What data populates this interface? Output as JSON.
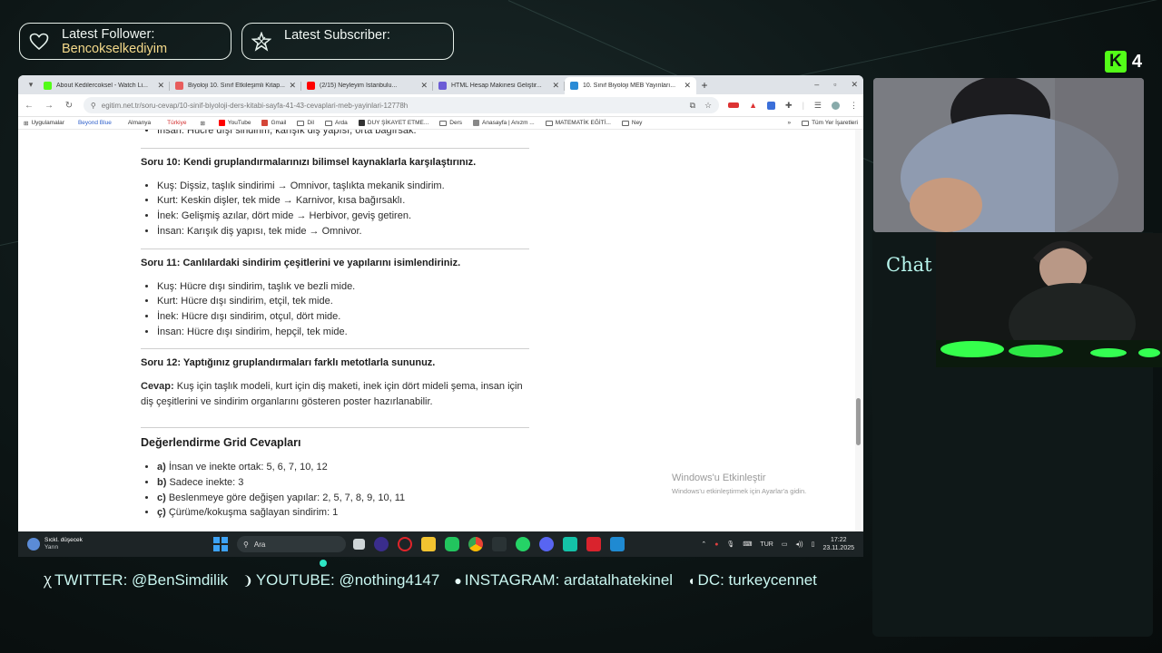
{
  "overlay": {
    "latest_follower_label": "Latest Follower:",
    "latest_follower_name": "Bencokselkediyim",
    "latest_subscriber_label": "Latest Subscriber:",
    "latest_subscriber_name": "",
    "brand_count": "4",
    "chat_title": "Chat",
    "socials": [
      {
        "icon": "twitter-icon",
        "text": "TWITTER: @BenSimdilik"
      },
      {
        "icon": "youtube-icon",
        "text": "YOUTUBE: @nothing4147"
      },
      {
        "icon": "instagram-icon",
        "text": "INSTAGRAM: ardatalhatekinel"
      },
      {
        "icon": "discord-icon",
        "text": "DC: turkeycennet"
      }
    ]
  },
  "browser": {
    "tabs": [
      {
        "title": "About Kedilercoksel - Watch Li...",
        "favicon_color": "#53fc18",
        "active": false
      },
      {
        "title": "Biyoloji 10. Sınıf Etkileşimli Kitap...",
        "favicon_color": "#e85d5d",
        "active": false
      },
      {
        "title": "(2/15) Neyleyim İstanbulu...",
        "favicon_color": "#ff0000",
        "active": false
      },
      {
        "title": "HTML Hesap Makinesi Geliştir...",
        "favicon_color": "#6b5bd6",
        "active": false
      },
      {
        "title": "10. Sınıf Biyoloji MEB Yayınları...",
        "favicon_color": "#2a8bd6",
        "active": true
      }
    ],
    "url": "egitim.net.tr/soru-cevap/10-sinif-biyoloji-ders-kitabi-sayfa-41-43-cevaplari-meb-yayinlari-12778h",
    "bookmarks": [
      {
        "label": "Uygulamalar",
        "type": "apps"
      },
      {
        "label": "Beyond Blue",
        "type": "badge",
        "color": "#2b5dc9"
      },
      {
        "label": "Almanya",
        "type": "badge",
        "color": "#333333"
      },
      {
        "label": "Türkiye",
        "type": "badge",
        "color": "#d22c2c"
      },
      {
        "label": "",
        "type": "grid"
      },
      {
        "label": "YouTube",
        "type": "site",
        "color": "#ff0000"
      },
      {
        "label": "Gmail",
        "type": "site",
        "color": "#d44638"
      },
      {
        "label": "Dil",
        "type": "folder"
      },
      {
        "label": "Arda",
        "type": "folder"
      },
      {
        "label": "DUY ŞİKAYET ETME...",
        "type": "site",
        "color": "#333333"
      },
      {
        "label": "Ders",
        "type": "folder"
      },
      {
        "label": "Anasayfa | Anızm ...",
        "type": "site",
        "color": "#888888"
      },
      {
        "label": "MATEMATİK EĞİTİ...",
        "type": "folder"
      },
      {
        "label": "Ney",
        "type": "folder"
      }
    ],
    "bookmarks_overflow": "»",
    "bookmarks_all": "Tüm Yer İşaretleri"
  },
  "article": {
    "top_partial": "İnsan: Hücre dışı sindirim, karışık diş yapısı, orta bağırsak.",
    "q10": "Soru 10: Kendi gruplandırmalarınızı bilimsel kaynaklarla karşılaştırınız.",
    "q10_items": [
      "Kuş: Dişsiz, taşlık sindirimi → Omnivor, taşlıkta mekanik sindirim.",
      "Kurt: Keskin dişler, tek mide → Karnivor, kısa bağırsaklı.",
      "İnek: Gelişmiş azılar, dört mide → Herbivor, geviş getiren.",
      "İnsan: Karışık diş yapısı, tek mide → Omnivor."
    ],
    "q11": "Soru 11: Canlılardaki sindirim çeşitlerini ve yapılarını isimlendiriniz.",
    "q11_items": [
      "Kuş: Hücre dışı sindirim, taşlık ve bezli mide.",
      "Kurt: Hücre dışı sindirim, etçil, tek mide.",
      "İnek: Hücre dışı sindirim, otçul, dört mide.",
      "İnsan: Hücre dışı sindirim, hepçil, tek mide."
    ],
    "q12": "Soru 12: Yaptığınız gruplandırmaları farklı metotlarla sununuz.",
    "q12_answer_label": "Cevap:",
    "q12_answer": " Kuş için taşlık modeli, kurt için diş maketi, inek için dört mideli şema, insan için diş çeşitlerini ve sindirim organlarını gösteren poster hazırlanabilir.",
    "grid_title": "Değerlendirme Grid Cevapları",
    "grid_items": [
      {
        "key": "a)",
        "text": " İnsan ve inekte ortak: 5, 6, 7, 10, 12"
      },
      {
        "key": "b)",
        "text": " Sadece inekte: 3"
      },
      {
        "key": "c)",
        "text": " Beslenmeye göre değişen yapılar: 2, 5, 7, 8, 9, 10, 11"
      },
      {
        "key": "ç)",
        "text": " Çürüme/kokuşma sağlayan sindirim: 1"
      }
    ]
  },
  "watermark": {
    "line1": "Windows'u Etkinleştir",
    "line2": "Windows'u etkinleştirmek için Ayarlar'a gidin."
  },
  "taskbar": {
    "weather_title": "Sıckl. düşecek",
    "weather_sub": "Yarın",
    "search_placeholder": "Ara",
    "language": "TUR",
    "time": "17:22",
    "date": "23.11.2025"
  }
}
